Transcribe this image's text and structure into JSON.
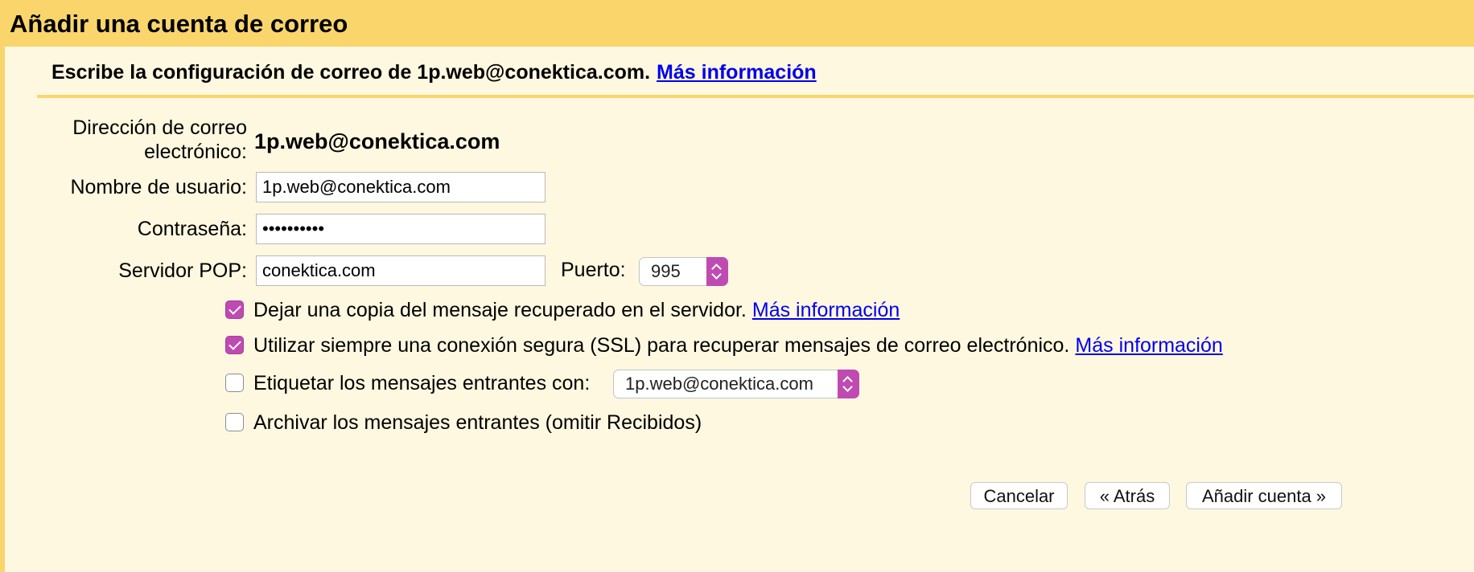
{
  "header": {
    "title": "Añadir una cuenta de correo"
  },
  "subheader": {
    "text": "Escribe la configuración de correo de 1p.web@conektica.com.",
    "link": "Más información"
  },
  "form": {
    "email_label_line1": "Dirección de correo",
    "email_label_line2": "electrónico:",
    "email_value": "1p.web@conektica.com",
    "username_label": "Nombre de usuario:",
    "username_value": "1p.web@conektica.com",
    "password_label": "Contraseña:",
    "password_value": "••••••••••",
    "pop_label": "Servidor POP:",
    "pop_value": "conektica.com",
    "port_label": "Puerto:",
    "port_value": "995"
  },
  "options": {
    "leave_copy": {
      "checked": true,
      "label": "Dejar una copia del mensaje recuperado en el servidor.",
      "link": "Más información"
    },
    "use_ssl": {
      "checked": true,
      "label": "Utilizar siempre una conexión segura (SSL) para recuperar mensajes de correo electrónico.",
      "link": "Más información"
    },
    "label_incoming": {
      "checked": false,
      "label": "Etiquetar los mensajes entrantes con:",
      "select_value": "1p.web@conektica.com"
    },
    "archive_incoming": {
      "checked": false,
      "label": "Archivar los mensajes entrantes (omitir Recibidos)"
    }
  },
  "buttons": {
    "cancel": "Cancelar",
    "back": "« Atrás",
    "add_account": "Añadir cuenta »"
  },
  "colors": {
    "header_bg": "#f9d56c",
    "panel_bg": "#fef8e0",
    "accent": "#bf4bb2",
    "link": "#0000ee"
  }
}
